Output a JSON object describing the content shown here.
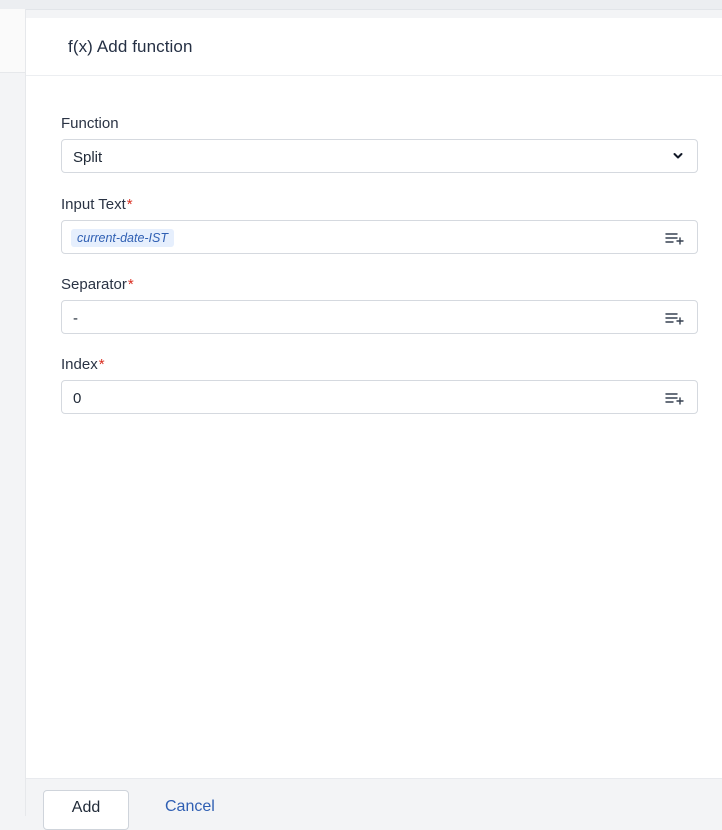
{
  "dialog": {
    "title": "f(x) Add function"
  },
  "fields": {
    "function": {
      "label": "Function",
      "value": "Split"
    },
    "input_text": {
      "label": "Input Text",
      "required_mark": "*",
      "chip": "current-date-IST"
    },
    "separator": {
      "label": "Separator",
      "required_mark": "*",
      "value": "-"
    },
    "index": {
      "label": "Index",
      "required_mark": "*",
      "value": "0"
    }
  },
  "footer": {
    "add_label": "Add",
    "cancel_label": "Cancel"
  },
  "icons": {
    "dropdown": "chevron-down-icon",
    "variable": "insert-variable-icon"
  },
  "colors": {
    "required": "#d92d20",
    "link": "#2f5fb3",
    "chip_bg": "#e6effd"
  }
}
